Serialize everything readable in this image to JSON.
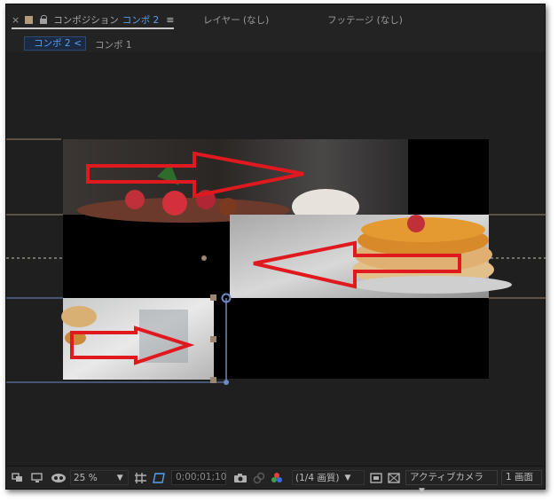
{
  "tabs": {
    "close_glyph": "×",
    "comp_label": "コンポジション",
    "comp_name": "コンポ 2",
    "menu_glyph": "≡",
    "layer_tab": "レイヤー (なし)",
    "footage_tab": "フッテージ (なし)"
  },
  "breadcrumb": {
    "active": "コンポ 2",
    "chevron": "<",
    "other": "コンポ 1"
  },
  "toolbar": {
    "zoom": "25 %",
    "timecode": "0;00;01;10",
    "resolution": "(1/4 画質)",
    "camera": "アクティブカメラ",
    "views": "1 画面"
  },
  "icons": [
    "always-preview-icon",
    "monitor-icon",
    "mask-icon",
    "grid-icon",
    "region-of-interest-icon",
    "camera-icon",
    "color-wheel-icon",
    "fast-preview-icon",
    "transparency-grid-icon"
  ],
  "colors": {
    "panel_bg": "#232323",
    "accent_blue": "#5aa0ea",
    "arrow_red": "#e0191e",
    "guide_tan": "#9b8670",
    "guide_blue": "#6f88c6"
  }
}
